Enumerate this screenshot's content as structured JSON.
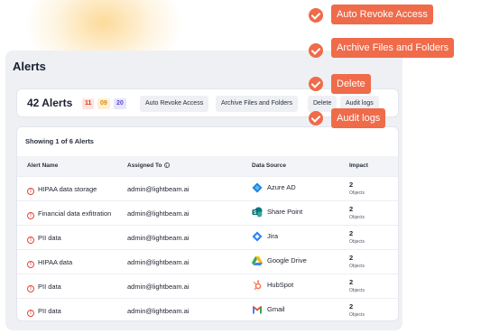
{
  "panel": {
    "title": "Alerts"
  },
  "toolbar": {
    "count_label": "42 Alerts",
    "badges": [
      "11",
      "09",
      "20"
    ],
    "buttons": [
      "Auto Revoke Access",
      "Archive Files and Folders",
      "Delete",
      "Audit logs"
    ]
  },
  "table": {
    "showing": "Showing 1 of 6 Alerts",
    "headers": [
      "Alert Name",
      "Assigned To",
      "Data Source",
      "Impact"
    ],
    "rows": [
      {
        "name": "HIPAA data storage",
        "assigned": "admin@lightbeam.ai",
        "source": "Azure AD",
        "source_icon": "azure-ad-icon",
        "impact": "2",
        "impact_label": "Objects"
      },
      {
        "name": "Financial data exfitration",
        "assigned": "admin@lightbeam.ai",
        "source": "Share Point",
        "source_icon": "sharepoint-icon",
        "impact": "2",
        "impact_label": "Objects"
      },
      {
        "name": "PII data",
        "assigned": "admin@lightbeam.ai",
        "source": "Jira",
        "source_icon": "jira-icon",
        "impact": "2",
        "impact_label": "Objects"
      },
      {
        "name": "HIPAA data",
        "assigned": "admin@lightbeam.ai",
        "source": "Google Drive",
        "source_icon": "google-drive-icon",
        "impact": "2",
        "impact_label": "Objects"
      },
      {
        "name": "PII data",
        "assigned": "admin@lightbeam.ai",
        "source": "HubSpot",
        "source_icon": "hubspot-icon",
        "impact": "2",
        "impact_label": "Objects"
      },
      {
        "name": "PII data",
        "assigned": "admin@lightbeam.ai",
        "source": "Gmail",
        "source_icon": "gmail-icon",
        "impact": "2",
        "impact_label": "Objects"
      }
    ]
  },
  "callouts": [
    "Auto Revoke Access",
    "Archive Files and Folders",
    "Delete",
    "Audit logs"
  ],
  "colors": {
    "accent": "#ef6b4a",
    "panel_bg": "#eef0f4",
    "alert_red": "#e2483a"
  }
}
